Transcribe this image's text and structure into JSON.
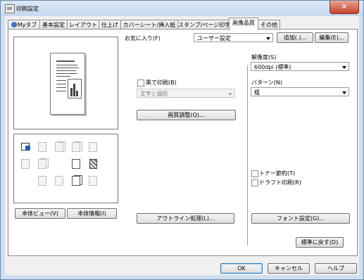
{
  "window": {
    "title": "印刷設定",
    "close_glyph": "✕"
  },
  "tabs": [
    {
      "label": "Myタブ"
    },
    {
      "label": "基本設定"
    },
    {
      "label": "レイアウト"
    },
    {
      "label": "仕上げ"
    },
    {
      "label": "カバーシート/挿入紙"
    },
    {
      "label": "スタンプ/ページ印字"
    },
    {
      "label": "画像品質",
      "active": true
    },
    {
      "label": "その他"
    }
  ],
  "favorites": {
    "label": "お気に入り(F)",
    "value": "ユーザー設定",
    "add_label": "追加(.)...",
    "edit_label": "編集(E)..."
  },
  "left_panel": {
    "view_label": "本体ビュー(V)",
    "info_label": "本体情報(I)"
  },
  "mono": {
    "label": "黒で印刷(B)",
    "checked": false,
    "dropdown_value": "文字と図形"
  },
  "image_adjust_label": "画質調整(Q)...",
  "outline_label": "アウトライン処理(L)...",
  "resolution": {
    "label": "解像度(S)",
    "value": "600dpi (標準)"
  },
  "pattern": {
    "label": "パターン(N)",
    "value": "粗"
  },
  "toner_save": {
    "label": "トナー節約(T)",
    "checked": false
  },
  "draft_print": {
    "label": "ドラフト印刷(R)",
    "checked": false
  },
  "font_settings_label": "フォント設定(G)...",
  "reset_label": "標準に戻す(D)",
  "footer": {
    "ok_label": "OK",
    "cancel_label": "キャンセル",
    "help_label": "ヘルプ"
  }
}
